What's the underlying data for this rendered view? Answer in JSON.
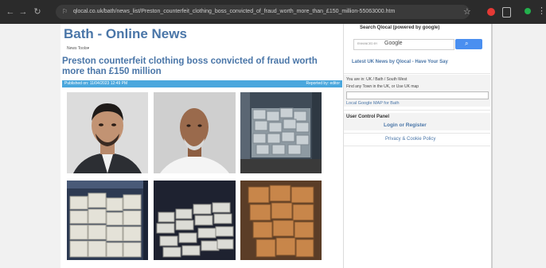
{
  "browser": {
    "url": "qlocal.co.uk/bath/news_list/Preston_counterfeit_clothing_boss_convicted_of_fraud_worth_more_than_£150_million-55063000.htm"
  },
  "page": {
    "site_title": "Bath - Online News",
    "news_tools": "News Tools▾",
    "headline": "Preston counterfeit clothing boss convicted of fraud worth more than £150 million",
    "meta_published": "Published on: 11/04/2023 12:49 PM",
    "meta_reported": "Reported by: editor"
  },
  "sidebar": {
    "search_heading": "Search Qlocal (powered by google)",
    "search_enhanced": "ENHANCED BY",
    "search_google": "Google",
    "latest_news": "Latest UK News by Qlocal - Have Your Say",
    "location_line1": "You are in: UK / Bath / South West",
    "location_line2": "Find any Town in the UK, or Use UK map",
    "map_link": "Local Google MAP for Bath",
    "ucp_title": "User Control Panel",
    "login_register": "Login or Register",
    "privacy": "Privacy & Cookie Policy"
  }
}
